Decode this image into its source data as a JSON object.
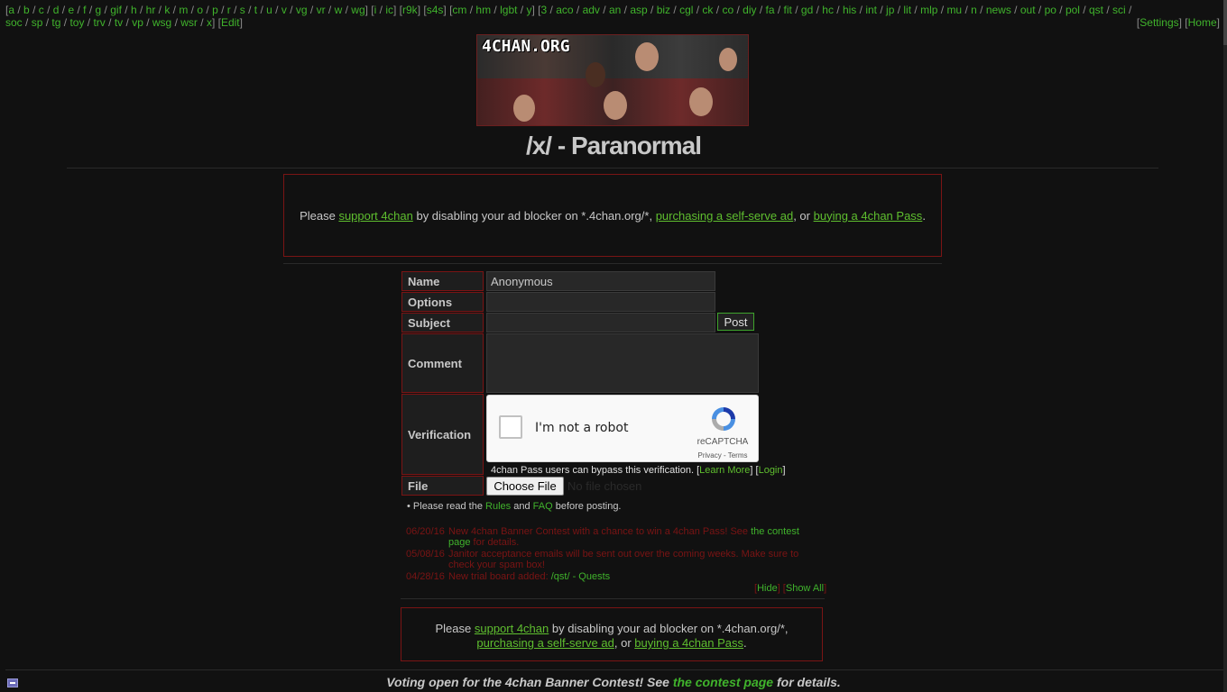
{
  "nav": {
    "groups": [
      [
        "a",
        "b",
        "c",
        "d",
        "e",
        "f",
        "g",
        "gif",
        "h",
        "hr",
        "k",
        "m",
        "o",
        "p",
        "r",
        "s",
        "t",
        "u",
        "v",
        "vg",
        "vr",
        "w",
        "wg"
      ],
      [
        "i",
        "ic"
      ],
      [
        "r9k"
      ],
      [
        "s4s"
      ],
      [
        "cm",
        "hm",
        "lgbt",
        "y"
      ],
      [
        "3",
        "aco",
        "adv",
        "an",
        "asp",
        "biz",
        "cgl",
        "ck",
        "co",
        "diy",
        "fa",
        "fit",
        "gd",
        "hc",
        "his",
        "int",
        "jp",
        "lit",
        "mlp",
        "mu",
        "n",
        "news",
        "out",
        "po",
        "pol",
        "qst",
        "sci",
        "soc",
        "sp",
        "tg",
        "toy",
        "trv",
        "tv",
        "vp",
        "wsg",
        "wsr",
        "x"
      ]
    ],
    "edit_label": "Edit",
    "settings_label": "Settings",
    "home_label": "Home"
  },
  "banner": {
    "logo_text": "4CHAN.ORG"
  },
  "board_title": "/x/ - Paranormal",
  "ad_notice": {
    "prefix": "Please",
    "support_link": "support 4chan",
    "middle": "by disabling your ad blocker on *.4chan.org/*,",
    "selfserve_link": "purchasing a self-serve ad",
    "or": ", or",
    "pass_link": "buying a 4chan Pass",
    "end": "."
  },
  "form": {
    "name_label": "Name",
    "name_value": "Anonymous",
    "options_label": "Options",
    "subject_label": "Subject",
    "post_label": "Post",
    "comment_label": "Comment",
    "verification_label": "Verification",
    "captcha_text": "I'm not a robot",
    "captcha_brand": "reCAPTCHA",
    "captcha_terms": "Privacy - Terms",
    "pass_note": "4chan Pass users can bypass this verification.",
    "learn_more": "Learn More",
    "login": "Login",
    "file_label": "File",
    "choose_file": "Choose File",
    "no_file": "No file chosen",
    "rules_prefix": "• Please read the",
    "rules_link": "Rules",
    "and": "and",
    "faq_link": "FAQ",
    "rules_suffix": "before posting."
  },
  "news": [
    {
      "date": "06/20/16",
      "text": "New 4chan Banner Contest with a chance to win a 4chan Pass! See",
      "link": "the contest page",
      "after": "for details."
    },
    {
      "date": "05/08/16",
      "text": "Janitor acceptance emails will be sent out over the coming weeks. Make sure to check your spam box!",
      "link": "",
      "after": ""
    },
    {
      "date": "04/28/16",
      "text": "New trial board added:",
      "link": "/qst/ - Quests",
      "after": ""
    }
  ],
  "news_controls": {
    "hide": "Hide",
    "show_all": "Show All"
  },
  "contest_banner": {
    "prefix": "Voting open for the 4chan Banner Contest! See",
    "link": "the contest page",
    "suffix": "for details."
  }
}
